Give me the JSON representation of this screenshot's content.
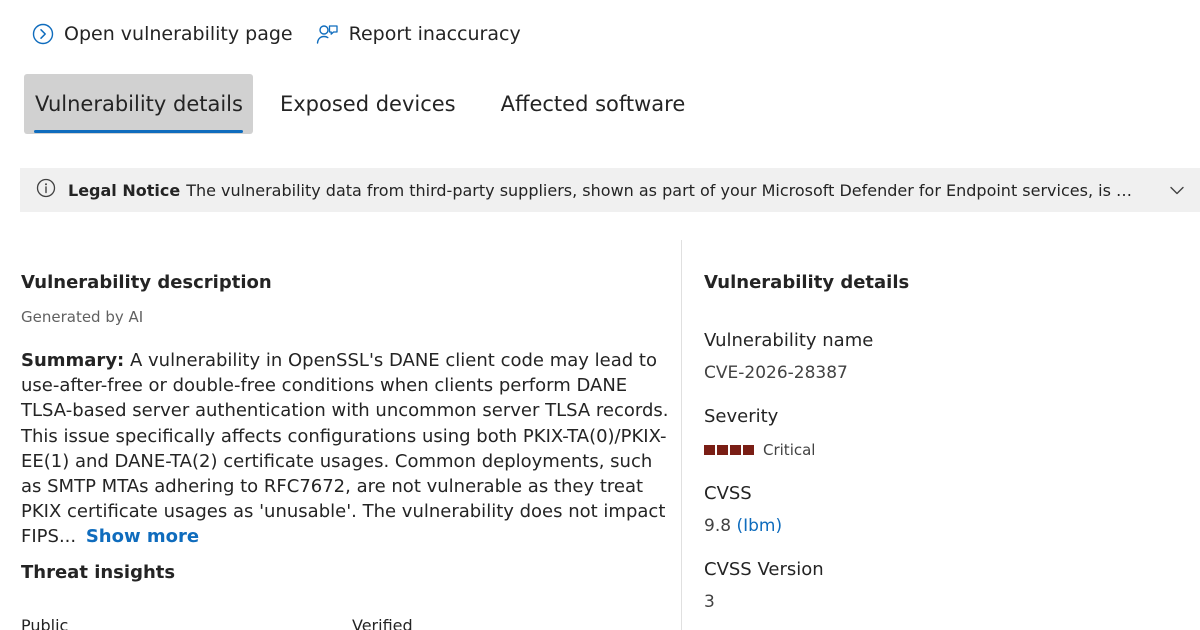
{
  "actions": {
    "open_page": "Open vulnerability page",
    "report": "Report inaccuracy"
  },
  "tabs": [
    {
      "label": "Vulnerability details",
      "active": true
    },
    {
      "label": "Exposed devices",
      "active": false
    },
    {
      "label": "Affected software",
      "active": false
    }
  ],
  "notice": {
    "title": "Legal Notice",
    "text": "The vulnerability data from third-party suppliers, shown as part of your Microsoft Defender for Endpoint services, is made available t..."
  },
  "description": {
    "title": "Vulnerability description",
    "generated_by": "Generated by AI",
    "summary_label": "Summary:",
    "summary_text": "A vulnerability in OpenSSL's DANE client code may lead to use-after-free or double-free conditions when clients perform DANE TLSA-based server authentication with uncommon server TLSA records. This issue specifically affects configurations using both PKIX-TA(0)/PKIX-EE(1) and DANE-TA(2) certificate usages. Common deployments, such as SMTP MTAs adhering to RFC7672, are not vulnerable as they treat PKIX certificate usages as 'unusable'. The vulnerability does not impact FIPS...",
    "show_more": "Show more"
  },
  "threat": {
    "title": "Threat insights",
    "col1": "Public",
    "col2": "Verified"
  },
  "details": {
    "title": "Vulnerability details",
    "name_label": "Vulnerability name",
    "name_value": "CVE-2026-28387",
    "severity_label": "Severity",
    "severity_value": "Critical",
    "severity_level": 4,
    "severity_color": "#7a1e15",
    "cvss_label": "CVSS",
    "cvss_score": "9.8",
    "cvss_source": "(Ibm)",
    "cvss_version_label": "CVSS Version",
    "cvss_version_value": "3"
  },
  "colors": {
    "accent": "#0f6cbd",
    "tab_active_bg": "#d1d1d1",
    "notice_bg": "#f0f0f0"
  }
}
